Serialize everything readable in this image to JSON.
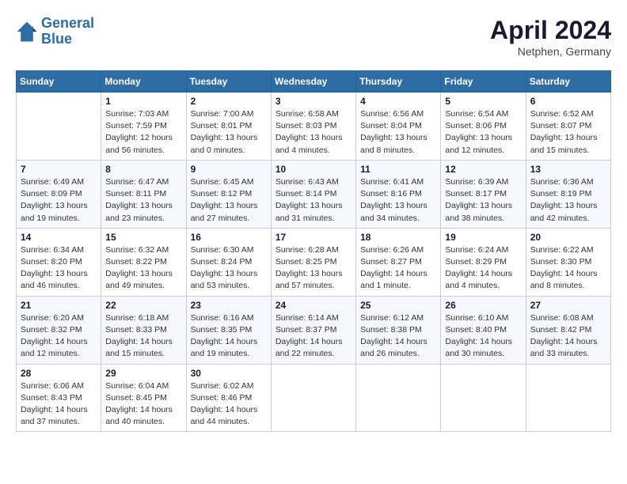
{
  "header": {
    "logo_line1": "General",
    "logo_line2": "Blue",
    "month": "April 2024",
    "location": "Netphen, Germany"
  },
  "weekdays": [
    "Sunday",
    "Monday",
    "Tuesday",
    "Wednesday",
    "Thursday",
    "Friday",
    "Saturday"
  ],
  "weeks": [
    [
      {
        "day": "",
        "info": ""
      },
      {
        "day": "1",
        "info": "Sunrise: 7:03 AM\nSunset: 7:59 PM\nDaylight: 12 hours\nand 56 minutes."
      },
      {
        "day": "2",
        "info": "Sunrise: 7:00 AM\nSunset: 8:01 PM\nDaylight: 13 hours\nand 0 minutes."
      },
      {
        "day": "3",
        "info": "Sunrise: 6:58 AM\nSunset: 8:03 PM\nDaylight: 13 hours\nand 4 minutes."
      },
      {
        "day": "4",
        "info": "Sunrise: 6:56 AM\nSunset: 8:04 PM\nDaylight: 13 hours\nand 8 minutes."
      },
      {
        "day": "5",
        "info": "Sunrise: 6:54 AM\nSunset: 8:06 PM\nDaylight: 13 hours\nand 12 minutes."
      },
      {
        "day": "6",
        "info": "Sunrise: 6:52 AM\nSunset: 8:07 PM\nDaylight: 13 hours\nand 15 minutes."
      }
    ],
    [
      {
        "day": "7",
        "info": "Sunrise: 6:49 AM\nSunset: 8:09 PM\nDaylight: 13 hours\nand 19 minutes."
      },
      {
        "day": "8",
        "info": "Sunrise: 6:47 AM\nSunset: 8:11 PM\nDaylight: 13 hours\nand 23 minutes."
      },
      {
        "day": "9",
        "info": "Sunrise: 6:45 AM\nSunset: 8:12 PM\nDaylight: 13 hours\nand 27 minutes."
      },
      {
        "day": "10",
        "info": "Sunrise: 6:43 AM\nSunset: 8:14 PM\nDaylight: 13 hours\nand 31 minutes."
      },
      {
        "day": "11",
        "info": "Sunrise: 6:41 AM\nSunset: 8:16 PM\nDaylight: 13 hours\nand 34 minutes."
      },
      {
        "day": "12",
        "info": "Sunrise: 6:39 AM\nSunset: 8:17 PM\nDaylight: 13 hours\nand 38 minutes."
      },
      {
        "day": "13",
        "info": "Sunrise: 6:36 AM\nSunset: 8:19 PM\nDaylight: 13 hours\nand 42 minutes."
      }
    ],
    [
      {
        "day": "14",
        "info": "Sunrise: 6:34 AM\nSunset: 8:20 PM\nDaylight: 13 hours\nand 46 minutes."
      },
      {
        "day": "15",
        "info": "Sunrise: 6:32 AM\nSunset: 8:22 PM\nDaylight: 13 hours\nand 49 minutes."
      },
      {
        "day": "16",
        "info": "Sunrise: 6:30 AM\nSunset: 8:24 PM\nDaylight: 13 hours\nand 53 minutes."
      },
      {
        "day": "17",
        "info": "Sunrise: 6:28 AM\nSunset: 8:25 PM\nDaylight: 13 hours\nand 57 minutes."
      },
      {
        "day": "18",
        "info": "Sunrise: 6:26 AM\nSunset: 8:27 PM\nDaylight: 14 hours\nand 1 minute."
      },
      {
        "day": "19",
        "info": "Sunrise: 6:24 AM\nSunset: 8:29 PM\nDaylight: 14 hours\nand 4 minutes."
      },
      {
        "day": "20",
        "info": "Sunrise: 6:22 AM\nSunset: 8:30 PM\nDaylight: 14 hours\nand 8 minutes."
      }
    ],
    [
      {
        "day": "21",
        "info": "Sunrise: 6:20 AM\nSunset: 8:32 PM\nDaylight: 14 hours\nand 12 minutes."
      },
      {
        "day": "22",
        "info": "Sunrise: 6:18 AM\nSunset: 8:33 PM\nDaylight: 14 hours\nand 15 minutes."
      },
      {
        "day": "23",
        "info": "Sunrise: 6:16 AM\nSunset: 8:35 PM\nDaylight: 14 hours\nand 19 minutes."
      },
      {
        "day": "24",
        "info": "Sunrise: 6:14 AM\nSunset: 8:37 PM\nDaylight: 14 hours\nand 22 minutes."
      },
      {
        "day": "25",
        "info": "Sunrise: 6:12 AM\nSunset: 8:38 PM\nDaylight: 14 hours\nand 26 minutes."
      },
      {
        "day": "26",
        "info": "Sunrise: 6:10 AM\nSunset: 8:40 PM\nDaylight: 14 hours\nand 30 minutes."
      },
      {
        "day": "27",
        "info": "Sunrise: 6:08 AM\nSunset: 8:42 PM\nDaylight: 14 hours\nand 33 minutes."
      }
    ],
    [
      {
        "day": "28",
        "info": "Sunrise: 6:06 AM\nSunset: 8:43 PM\nDaylight: 14 hours\nand 37 minutes."
      },
      {
        "day": "29",
        "info": "Sunrise: 6:04 AM\nSunset: 8:45 PM\nDaylight: 14 hours\nand 40 minutes."
      },
      {
        "day": "30",
        "info": "Sunrise: 6:02 AM\nSunset: 8:46 PM\nDaylight: 14 hours\nand 44 minutes."
      },
      {
        "day": "",
        "info": ""
      },
      {
        "day": "",
        "info": ""
      },
      {
        "day": "",
        "info": ""
      },
      {
        "day": "",
        "info": ""
      }
    ]
  ]
}
